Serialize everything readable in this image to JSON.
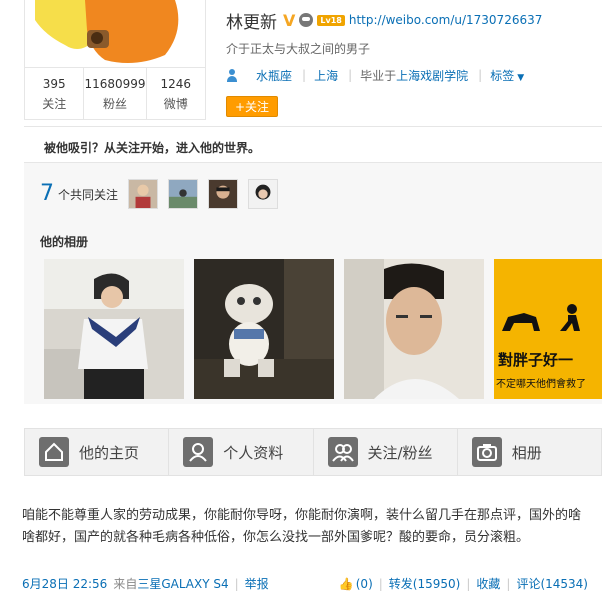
{
  "profile": {
    "name": "林更新",
    "level_badge": "Lv18",
    "url": "http://weibo.com/u/1730726637",
    "description": "介于正太与大叔之间的男子",
    "info": {
      "zodiac": "水瓶座",
      "city": "上海",
      "edu_prefix": "毕业于",
      "school": "上海戏剧学院",
      "tags": "标签"
    },
    "follow_button": "+关注",
    "stats": [
      {
        "value": "395",
        "label": "关注"
      },
      {
        "value": "11680999",
        "label": "粉丝"
      },
      {
        "value": "1246",
        "label": "微博"
      }
    ]
  },
  "panel": {
    "title": "被他吸引？从关注开始，进入他的世界。",
    "mutual_count": "7",
    "mutual_label": "个共同关注",
    "album_title": "他的相册",
    "photo4_text_line1": "對胖子好一",
    "photo4_text_line2": "不定哪天他們會救了"
  },
  "tabs": [
    {
      "label": "他的主页",
      "icon": "home-icon"
    },
    {
      "label": "个人资料",
      "icon": "profile-icon"
    },
    {
      "label": "关注/粉丝",
      "icon": "follow-icon"
    },
    {
      "label": "相册",
      "icon": "camera-icon"
    }
  ],
  "post": {
    "text": "咱能不能尊重人家的劳动成果，你能耐你导呀，你能耐你演啊，装什么留几手在那点评，国外的啥啥都好，国产的就各种毛病各种低俗，你怎么没找一部外国爹呢？酸的要命，员分滚粗。",
    "time": "6月28日 22:56",
    "from": "来自",
    "device": "三星GALAXY S4",
    "report": "举报",
    "likes": "(0)",
    "repost": "转发(15950)",
    "favorite": "收藏",
    "comment": "评论(14534)"
  },
  "colors": {
    "link": "#0a6fb5",
    "follow_button": "#ff9c00",
    "v_badge": "#f5a623"
  }
}
